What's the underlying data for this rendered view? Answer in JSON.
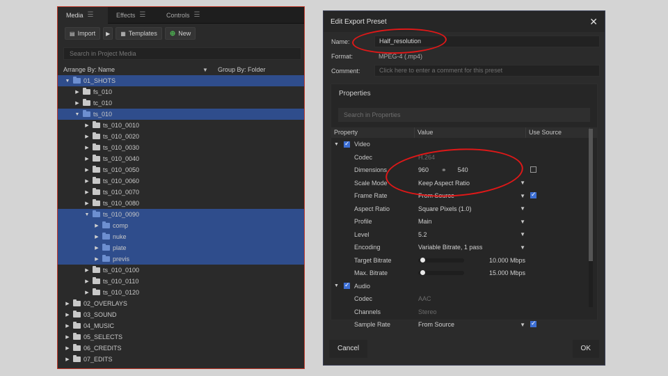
{
  "media_panel": {
    "tabs": [
      {
        "label": "Media",
        "active": true
      },
      {
        "label": "Effects",
        "active": false
      },
      {
        "label": "Controls",
        "active": false
      }
    ],
    "toolbar": {
      "import_label": "Import",
      "templates_label": "Templates",
      "new_label": "New"
    },
    "search_placeholder": "Search in Project Media",
    "arrange_by": "Arrange By: Name",
    "group_by": "Group By: Folder",
    "tree": [
      {
        "label": "01_SHOTS",
        "depth": 0,
        "expanded": true,
        "selected": true
      },
      {
        "label": "fs_010",
        "depth": 1,
        "expanded": false,
        "selected": false
      },
      {
        "label": "tc_010",
        "depth": 1,
        "expanded": false,
        "selected": false
      },
      {
        "label": "ts_010",
        "depth": 1,
        "expanded": true,
        "selected": true
      },
      {
        "label": "ts_010_0010",
        "depth": 2,
        "expanded": false,
        "selected": false
      },
      {
        "label": "ts_010_0020",
        "depth": 2,
        "expanded": false,
        "selected": false
      },
      {
        "label": "ts_010_0030",
        "depth": 2,
        "expanded": false,
        "selected": false
      },
      {
        "label": "ts_010_0040",
        "depth": 2,
        "expanded": false,
        "selected": false
      },
      {
        "label": "ts_010_0050",
        "depth": 2,
        "expanded": false,
        "selected": false
      },
      {
        "label": "ts_010_0060",
        "depth": 2,
        "expanded": false,
        "selected": false
      },
      {
        "label": "ts_010_0070",
        "depth": 2,
        "expanded": false,
        "selected": false
      },
      {
        "label": "ts_010_0080",
        "depth": 2,
        "expanded": false,
        "selected": false
      },
      {
        "label": "ts_010_0090",
        "depth": 2,
        "expanded": true,
        "selected": true
      },
      {
        "label": "comp",
        "depth": 3,
        "expanded": false,
        "selected": true
      },
      {
        "label": "nuke",
        "depth": 3,
        "expanded": false,
        "selected": true
      },
      {
        "label": "plate",
        "depth": 3,
        "expanded": false,
        "selected": true
      },
      {
        "label": "previs",
        "depth": 3,
        "expanded": false,
        "selected": true
      },
      {
        "label": "ts_010_0100",
        "depth": 2,
        "expanded": false,
        "selected": false
      },
      {
        "label": "ts_010_0110",
        "depth": 2,
        "expanded": false,
        "selected": false
      },
      {
        "label": "ts_010_0120",
        "depth": 2,
        "expanded": false,
        "selected": false
      },
      {
        "label": "02_OVERLAYS",
        "depth": 0,
        "expanded": false,
        "selected": false
      },
      {
        "label": "03_SOUND",
        "depth": 0,
        "expanded": false,
        "selected": false
      },
      {
        "label": "04_MUSIC",
        "depth": 0,
        "expanded": false,
        "selected": false
      },
      {
        "label": "05_SELECTS",
        "depth": 0,
        "expanded": false,
        "selected": false
      },
      {
        "label": "06_CREDITS",
        "depth": 0,
        "expanded": false,
        "selected": false
      },
      {
        "label": "07_EDITS",
        "depth": 0,
        "expanded": false,
        "selected": false
      }
    ]
  },
  "dialog": {
    "title": "Edit Export Preset",
    "name_label": "Name:",
    "name_value": "Half_resolution",
    "format_label": "Format:",
    "format_value": "MPEG-4 (.mp4)",
    "comment_label": "Comment:",
    "comment_placeholder": "Click here to enter a comment for this preset",
    "properties_header": "Properties",
    "properties_search_placeholder": "Search in Properties",
    "columns": {
      "property": "Property",
      "value": "Value",
      "use_source": "Use Source"
    },
    "rows": [
      {
        "kind": "group",
        "label": "Video",
        "checked": true
      },
      {
        "kind": "static",
        "label": "Codec",
        "value": "H.264"
      },
      {
        "kind": "dimensions",
        "label": "Dimensions",
        "width": "960",
        "height": "540",
        "use_source": false
      },
      {
        "kind": "select",
        "label": "Scale Mode",
        "value": "Keep Aspect Ratio"
      },
      {
        "kind": "select",
        "label": "Frame Rate",
        "value": "From Source",
        "use_source": true
      },
      {
        "kind": "select",
        "label": "Aspect Ratio",
        "value": "Square Pixels (1.0)"
      },
      {
        "kind": "select",
        "label": "Profile",
        "value": "Main"
      },
      {
        "kind": "select",
        "label": "Level",
        "value": "5.2"
      },
      {
        "kind": "select",
        "label": "Encoding",
        "value": "Variable Bitrate, 1 pass"
      },
      {
        "kind": "slider",
        "label": "Target Bitrate",
        "value": "10.000 Mbps",
        "level": 0.05
      },
      {
        "kind": "slider",
        "label": "Max. Bitrate",
        "value": "15.000 Mbps",
        "level": 0.05
      },
      {
        "kind": "group",
        "label": "Audio",
        "checked": true
      },
      {
        "kind": "static",
        "label": "Codec",
        "value": "AAC"
      },
      {
        "kind": "static",
        "label": "Channels",
        "value": "Stereo"
      },
      {
        "kind": "select",
        "label": "Sample Rate",
        "value": "From Source",
        "use_source": true
      }
    ],
    "cancel_label": "Cancel",
    "ok_label": "OK"
  }
}
